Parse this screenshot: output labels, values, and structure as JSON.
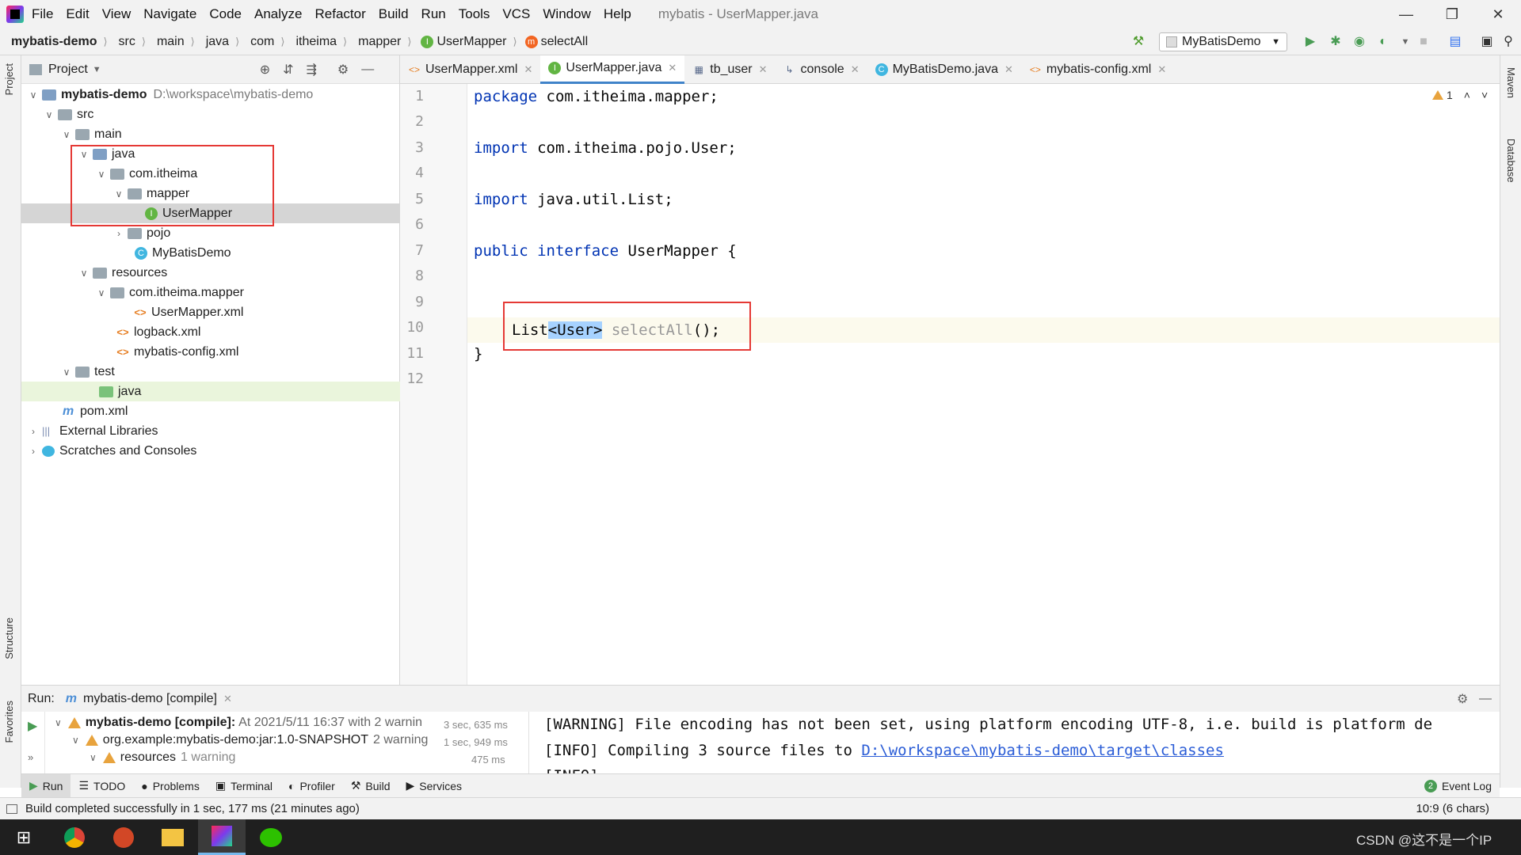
{
  "menubar": {
    "items": [
      "File",
      "Edit",
      "View",
      "Navigate",
      "Code",
      "Analyze",
      "Refactor",
      "Build",
      "Run",
      "Tools",
      "VCS",
      "Window",
      "Help"
    ],
    "title": "mybatis - UserMapper.java"
  },
  "navbar": {
    "breadcrumbs": [
      "mybatis-demo",
      "src",
      "main",
      "java",
      "com",
      "itheima",
      "mapper",
      "UserMapper",
      "selectAll"
    ],
    "run_config": "MyBatisDemo"
  },
  "project": {
    "header": "Project",
    "tree": [
      {
        "label": "mybatis-demo",
        "extra": "D:\\workspace\\mybatis-demo",
        "bold": true
      },
      {
        "label": "src"
      },
      {
        "label": "main"
      },
      {
        "label": "java"
      },
      {
        "label": "com.itheima"
      },
      {
        "label": "mapper"
      },
      {
        "label": "UserMapper"
      },
      {
        "label": "pojo"
      },
      {
        "label": "MyBatisDemo"
      },
      {
        "label": "resources"
      },
      {
        "label": "com.itheima.mapper"
      },
      {
        "label": "UserMapper.xml"
      },
      {
        "label": "logback.xml"
      },
      {
        "label": "mybatis-config.xml"
      },
      {
        "label": "test"
      },
      {
        "label": "java"
      },
      {
        "label": "pom.xml"
      },
      {
        "label": "External Libraries"
      },
      {
        "label": "Scratches and Consoles"
      }
    ]
  },
  "tabs": [
    "UserMapper.xml",
    "UserMapper.java",
    "tb_user",
    "console",
    "MyBatisDemo.java",
    "mybatis-config.xml"
  ],
  "editor": {
    "line_numbers": [
      "1",
      "2",
      "3",
      "4",
      "5",
      "6",
      "7",
      "8",
      "9",
      "10",
      "11",
      "12"
    ],
    "warning_count": "1",
    "code": {
      "l1_kw": "package",
      "l1_rest": " com.itheima.mapper;",
      "l3_kw": "import",
      "l3_rest": " com.itheima.pojo.User;",
      "l5_kw": "import",
      "l5_rest": " java.util.List;",
      "l7_kw1": "public",
      "l7_kw2": " interface",
      "l7_rest": " UserMapper {",
      "l10_a": "List",
      "l10_sel": "<User>",
      "l10_b": " selectAll",
      "l10_c": "();",
      "l11": "}"
    }
  },
  "run": {
    "label": "Run:",
    "tab": "mybatis-demo [compile]",
    "tree": [
      {
        "label": "mybatis-demo [compile]:",
        "detail": "At 2021/5/11 16:37 with 2 warnin",
        "time": "3 sec, 635 ms"
      },
      {
        "label": "org.example:mybatis-demo:jar:1.0-SNAPSHOT",
        "detail": "2 warning",
        "time": "1 sec, 949 ms"
      },
      {
        "label": "resources",
        "detail": "1 warning",
        "time": "475 ms"
      }
    ],
    "console_1": "[WARNING] File encoding has not been set, using platform encoding UTF-8, i.e. build is platform de",
    "console_2a": "[INFO] Compiling 3 source files to ",
    "console_2b": "D:\\workspace\\mybatis-demo\\target\\classes",
    "console_3": "[INFO]"
  },
  "bottom_tabs": [
    "Run",
    "TODO",
    "Problems",
    "Terminal",
    "Profiler",
    "Build",
    "Services"
  ],
  "event_log": "Event Log",
  "event_count": "2",
  "status": {
    "message": "Build completed successfully in 1 sec, 177 ms (21 minutes ago)",
    "position": "10:9 (6 chars)"
  },
  "side_tabs": {
    "project": "Project",
    "structure": "Structure",
    "favorites": "Favorites",
    "maven": "Maven",
    "database": "Database"
  },
  "watermark": "CSDN @这不是一个IP"
}
